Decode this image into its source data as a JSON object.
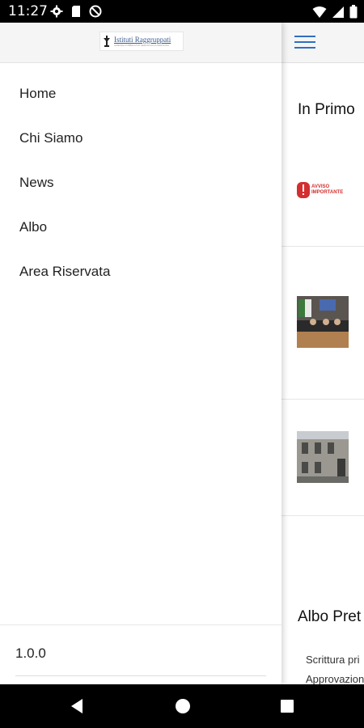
{
  "status_bar": {
    "time": "11:27",
    "icons_left": [
      "gear-icon",
      "sd-card-icon",
      "no-disturb-icon"
    ],
    "icons_right": [
      "wifi-icon",
      "signal-icon",
      "battery-icon"
    ]
  },
  "drawer": {
    "logo": {
      "title": "Istituti Raggruppati",
      "subtitle": "AZIENDA PUBBLICA DI SERVIZI ALLA PERSONA"
    },
    "menu_items": [
      {
        "label": "Home"
      },
      {
        "label": "Chi Siamo"
      },
      {
        "label": "News"
      },
      {
        "label": "Albo"
      },
      {
        "label": "Area Riservata"
      }
    ],
    "version": "1.0.0"
  },
  "content": {
    "section1_title": "In Primo",
    "avviso_label": "AVVISO IMPORTANTE",
    "section2_title": "Albo Pret",
    "albo_items": [
      "Scrittura pri",
      "Approvazion"
    ]
  },
  "colors": {
    "accent": "#2f6fc2",
    "avviso_red": "#d32f2f"
  }
}
